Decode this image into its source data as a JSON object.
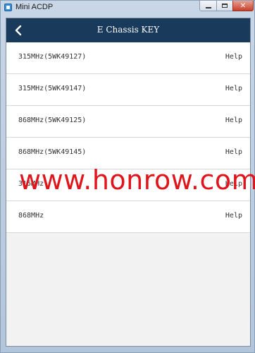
{
  "window": {
    "title": "Mini ACDP",
    "controls": {
      "minimize": "minimize",
      "maximize": "maximize",
      "close": "✕"
    }
  },
  "navbar": {
    "back_icon": "chevron-left-icon",
    "title": "E Chassis KEY"
  },
  "list": {
    "items": [
      {
        "label": "315MHz(5WK49127)",
        "action": "Help"
      },
      {
        "label": "315MHz(5WK49147)",
        "action": "Help"
      },
      {
        "label": "868MHz(5WK49125)",
        "action": "Help"
      },
      {
        "label": "868MHz(5WK49145)",
        "action": "Help"
      },
      {
        "label": "315MHz",
        "action": "Help"
      },
      {
        "label": "868MHz",
        "action": "Help"
      }
    ]
  },
  "watermark": "www.honrow.com",
  "colors": {
    "navbar": "#1a3a5c",
    "watermark": "#e0141b",
    "background": "#f2f2f2"
  }
}
